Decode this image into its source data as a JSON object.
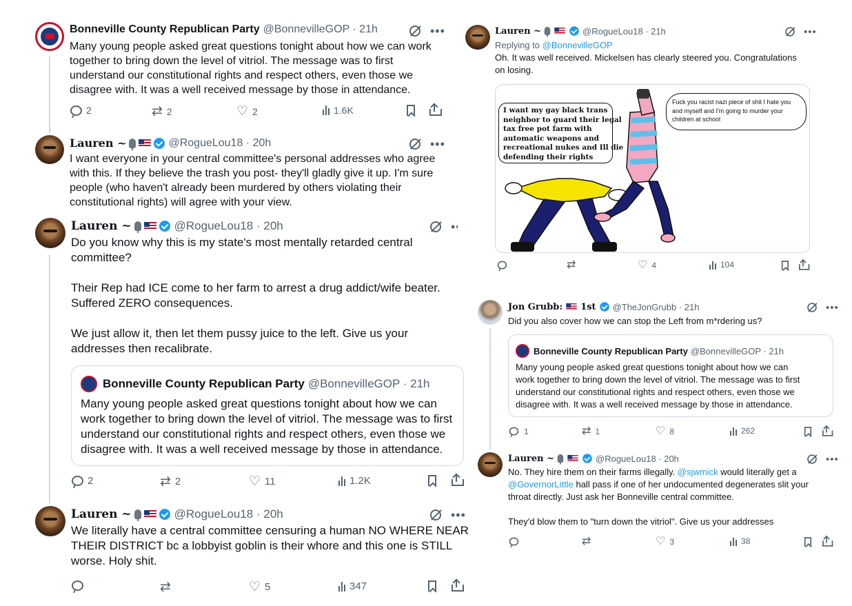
{
  "panel1": {
    "tweet_gop": {
      "name": "Bonneville County Republican Party",
      "meta": "@BonnevilleGOP · 21h",
      "lines": [
        "Many young people asked great questions tonight about how we can work",
        "together to bring down the level of vitriol. The message was to first",
        "understand our constitutional rights and respect others, even those we",
        "disagree with. It was a well received message by those in attendance."
      ],
      "replies": "2",
      "reposts": "2",
      "likes": "2",
      "views": "1.6K"
    },
    "tweet_lauren": {
      "name": "Lauren ~",
      "meta": "@RogueLou18 · 20h",
      "lines": [
        "I want everyone in your central committee's personal addresses who agree",
        "with this. If they believe the trash you post- they'll gladly give it up. I'm sure",
        "people (who haven't already been murdered by others violating their",
        "constitutional rights) will agree with your view."
      ]
    }
  },
  "panel2": {
    "tweet_main": {
      "name": "Lauren ~",
      "meta": "@RogueLou18 · 20h",
      "lines": [
        "Do you know why this is my state's most mentally retarded central",
        "committee?",
        "",
        "Their Rep had ICE come to her farm to arrest a drug addict/wife beater.",
        "Suffered ZERO consequences.",
        "",
        "We just allow it, then let them pussy juice to the left. Give us your",
        "addresses then recalibrate."
      ],
      "quote": {
        "name": "Bonneville County Republican Party",
        "meta": "@BonnevilleGOP · 21h",
        "lines": [
          "Many young people asked great questions tonight about how we can",
          "work together to bring down the level of vitriol. The message was to first",
          "understand our constitutional rights and respect others, even those we",
          "disagree with. It was a well received message by those in attendance."
        ]
      },
      "replies": "2",
      "reposts": "2",
      "likes": "11",
      "views": "1.2K"
    },
    "tweet_second": {
      "name": "Lauren ~",
      "meta": "@RogueLou18 · 20h",
      "lines": [
        "We literally have a central committee censuring a human NO WHERE NEAR",
        "THEIR DISTRICT bc a lobbyist goblin is their whore and this one is STILL",
        "worse. Holy shit."
      ],
      "replies": "",
      "reposts": "",
      "likes": "5",
      "views": "347"
    }
  },
  "panel3": {
    "name": "Lauren ~",
    "meta": "@RogueLou18 · 21h",
    "replying_prefix": "Replying to ",
    "replying_handle": "@BonnevilleGOP",
    "lines": [
      "Oh. It was well received. Mickelsen has clearly steered you. Congratulations",
      "on losing."
    ],
    "comic": {
      "left_bubble": [
        "I want my gay black trans",
        "neighbor to guard their legal",
        "tax free pot farm with",
        "automatic weapons and",
        "recreational nukes and Ill die",
        "defending their rights"
      ],
      "right_bubble": [
        "Fuck you racist nazi piece of shit I hate you",
        "and myself and I'm going to murder your",
        "children at school"
      ]
    },
    "replies": "",
    "reposts": "",
    "likes": "4",
    "views": "104"
  },
  "panel4": {
    "tweet_jon": {
      "name": "Jon Grubb:",
      "name_suffix": "1st",
      "meta": "@TheJonGrubb · 21h",
      "lines": [
        "Did you also cover how we can stop the Left from m*rdering us?"
      ],
      "quote": {
        "name": "Bonneville County Republican Party",
        "meta": "@BonnevilleGOP · 21h",
        "lines": [
          "Many young people asked great questions tonight about how we can",
          "work together to bring down the level of vitriol. The message was to first",
          "understand our constitutional rights and respect others, even those we",
          "disagree with. It was a well received message by those in attendance."
        ]
      },
      "replies": "1",
      "reposts": "1",
      "likes": "8",
      "views": "262"
    },
    "tweet_lauren": {
      "name": "Lauren ~",
      "meta": "@RogueLou18 · 20h",
      "line1_pre": "No. They hire them on their farms illegally. ",
      "line1_link": "@sjwmick",
      "line1_post": " would literally get a",
      "line2_link": "@GovernorLittle",
      "line2_post": " hall pass if one of her undocumented degenerates slit your",
      "line3": "throat directly. Just ask her Bonneville central committee.",
      "line5": "They'd blow them to \"turn down the vitriol\". Give us your addresses",
      "replies": "",
      "reposts": "",
      "likes": "3",
      "views": "38"
    }
  }
}
